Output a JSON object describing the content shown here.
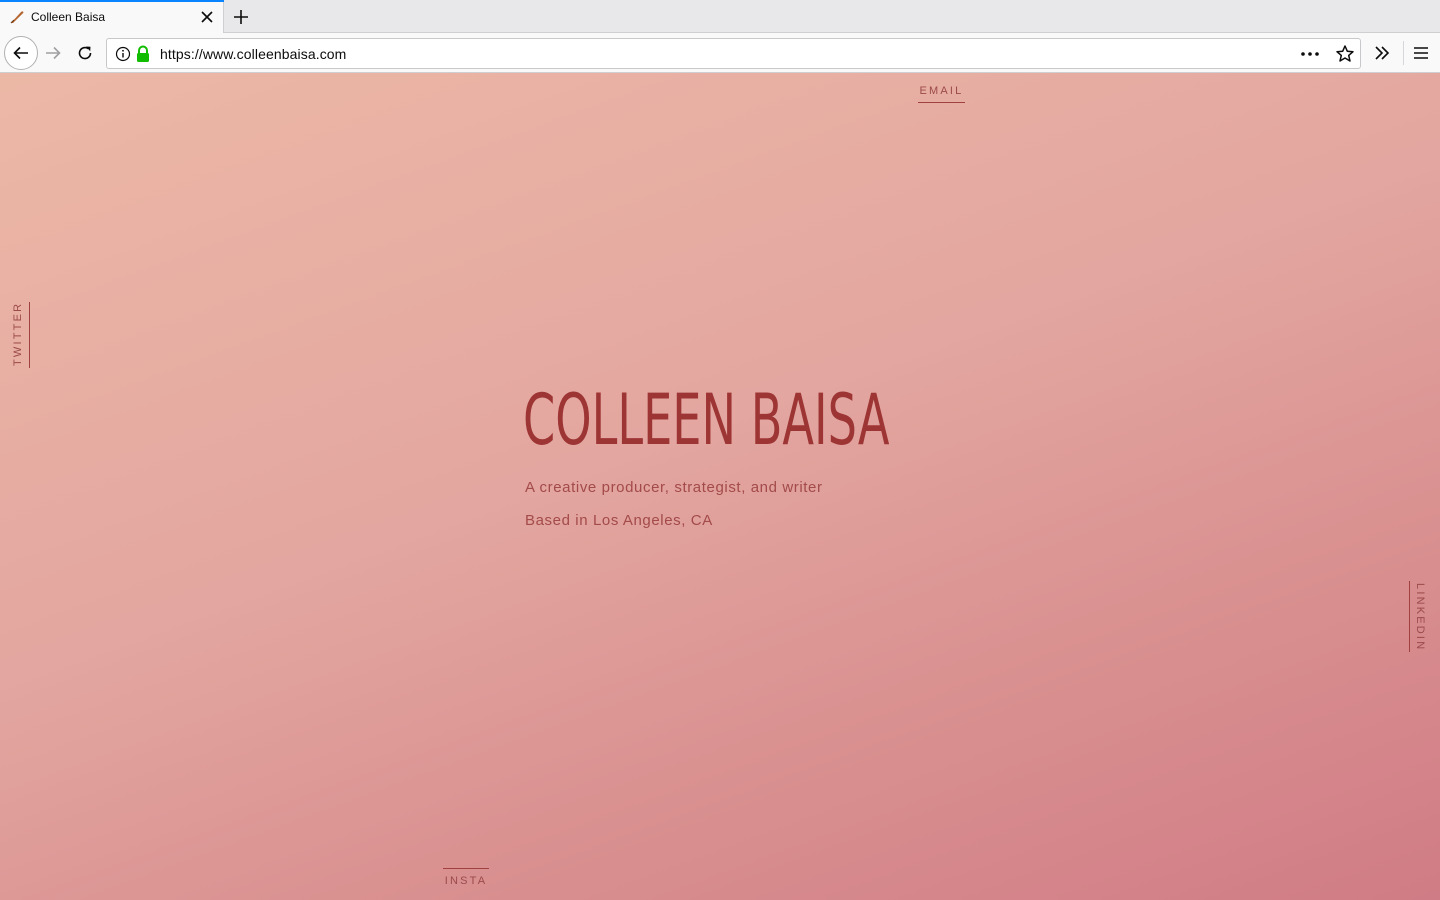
{
  "browser": {
    "tab": {
      "title": "Colleen Baisa"
    },
    "urlbar": {
      "url": "https://www.colleenbaisa.com"
    },
    "accent_color": "#0a84ff",
    "secure_lock_color": "#12bc00"
  },
  "page": {
    "links": {
      "email": "EMAIL",
      "twitter": "TWITTER",
      "linkedin": "LINKEDIN",
      "insta": "INSTA"
    },
    "hero": {
      "name": "COLLEEN BAISA",
      "tagline": "A creative producer, strategist, and writer",
      "location": "Based in Los Angeles, CA"
    },
    "colors": {
      "gradient_start": "#ecb8a6",
      "gradient_end": "#d07c86",
      "title": "#9e3535",
      "text": "#a34a4a"
    }
  }
}
